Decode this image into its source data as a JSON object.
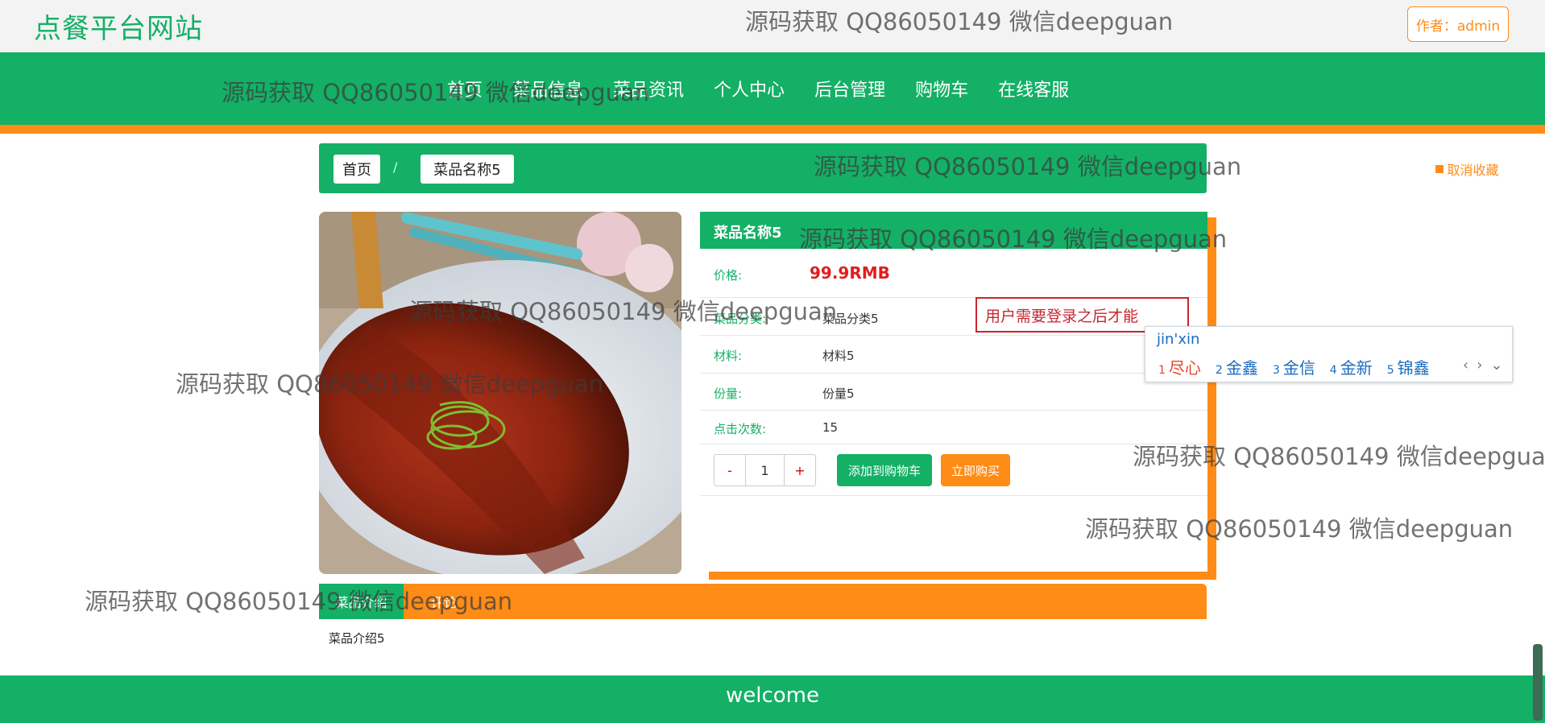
{
  "header": {
    "logo": "点餐平台网站",
    "author_label": "作者：admin"
  },
  "nav": {
    "items": [
      "首页",
      "菜品信息",
      "菜品资讯",
      "个人中心",
      "后台管理",
      "购物车",
      "在线客服"
    ]
  },
  "breadcrumb": {
    "home": "首页",
    "separator": "/",
    "current": "菜品名称5",
    "favorite_label": "取消收藏"
  },
  "product": {
    "title": "菜品名称5",
    "price_label": "价格:",
    "price_value": "99.9RMB",
    "category_label": "菜品分类:",
    "category_value": "菜品分类5",
    "material_label": "材料:",
    "material_value": "材料5",
    "portion_label": "份量:",
    "portion_value": "份量5",
    "clicks_label": "点击次数:",
    "clicks_value": "15",
    "qty_minus": "-",
    "qty_value": "1",
    "qty_plus": "+",
    "add_cart_label": "添加到购物车",
    "buy_now_label": "立即购买"
  },
  "login_tip": "用户需要登录之后才能",
  "ime": {
    "composition": "jin'xin",
    "candidates": [
      {
        "num": "1",
        "text": "尽心"
      },
      {
        "num": "2",
        "text": "金鑫"
      },
      {
        "num": "3",
        "text": "金信"
      },
      {
        "num": "4",
        "text": "金新"
      },
      {
        "num": "5",
        "text": "锦鑫"
      }
    ],
    "prev": "‹",
    "next": "›",
    "expand": "⌄"
  },
  "tabs": {
    "intro_tab": "菜品介绍",
    "comment_tab": "评论"
  },
  "intro_text": "菜品介绍5",
  "footer": {
    "text": "welcome"
  },
  "watermark": "源码获取 QQ86050149 微信deepguan",
  "colors": {
    "brand_green": "#14b066",
    "accent_orange": "#ff8c16",
    "price_red": "#e11d1d",
    "tip_red": "#c8272f"
  }
}
